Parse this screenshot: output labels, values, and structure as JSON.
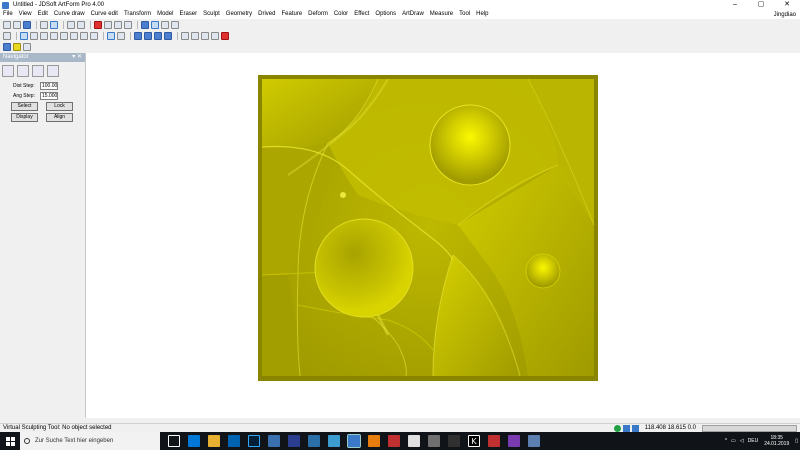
{
  "window": {
    "title": "Untitled - JDSoft ArtForm Pro 4.00",
    "controls": [
      "–",
      "▢",
      "✕"
    ]
  },
  "menu": {
    "items": [
      "File",
      "View",
      "Edit",
      "Curve draw",
      "Curve edit",
      "Transform",
      "Model",
      "Eraser",
      "Sculpt",
      "Geometry",
      "Drived",
      "Feature",
      "Deform",
      "Color",
      "Effect",
      "Options",
      "ArtDraw",
      "Measure",
      "Tool",
      "Help"
    ],
    "user": "Jingdiao"
  },
  "navigator": {
    "title": "Navigator",
    "pin": "▾ ✕",
    "dist_label": "Dist Step:",
    "dist_value": "100.00(",
    "ang_label": "Ang Step:",
    "ang_value": "15.000",
    "select_label": "Select",
    "lock_label": "Lock",
    "display_label": "Display",
    "align_label": "Align"
  },
  "status": {
    "message": "Virtual Sculpting Tool: No object selected",
    "coords": "118.408 18.615 0.0"
  },
  "taskbar": {
    "search_placeholder": "Zur Suche Text hier eingeben",
    "tray_lang": "DEU",
    "time": "18:35",
    "date": "24.01.2019"
  },
  "colors": {
    "relief_base": "#b5b000",
    "relief_light": "#e8e300",
    "relief_dark": "#7a7600"
  }
}
